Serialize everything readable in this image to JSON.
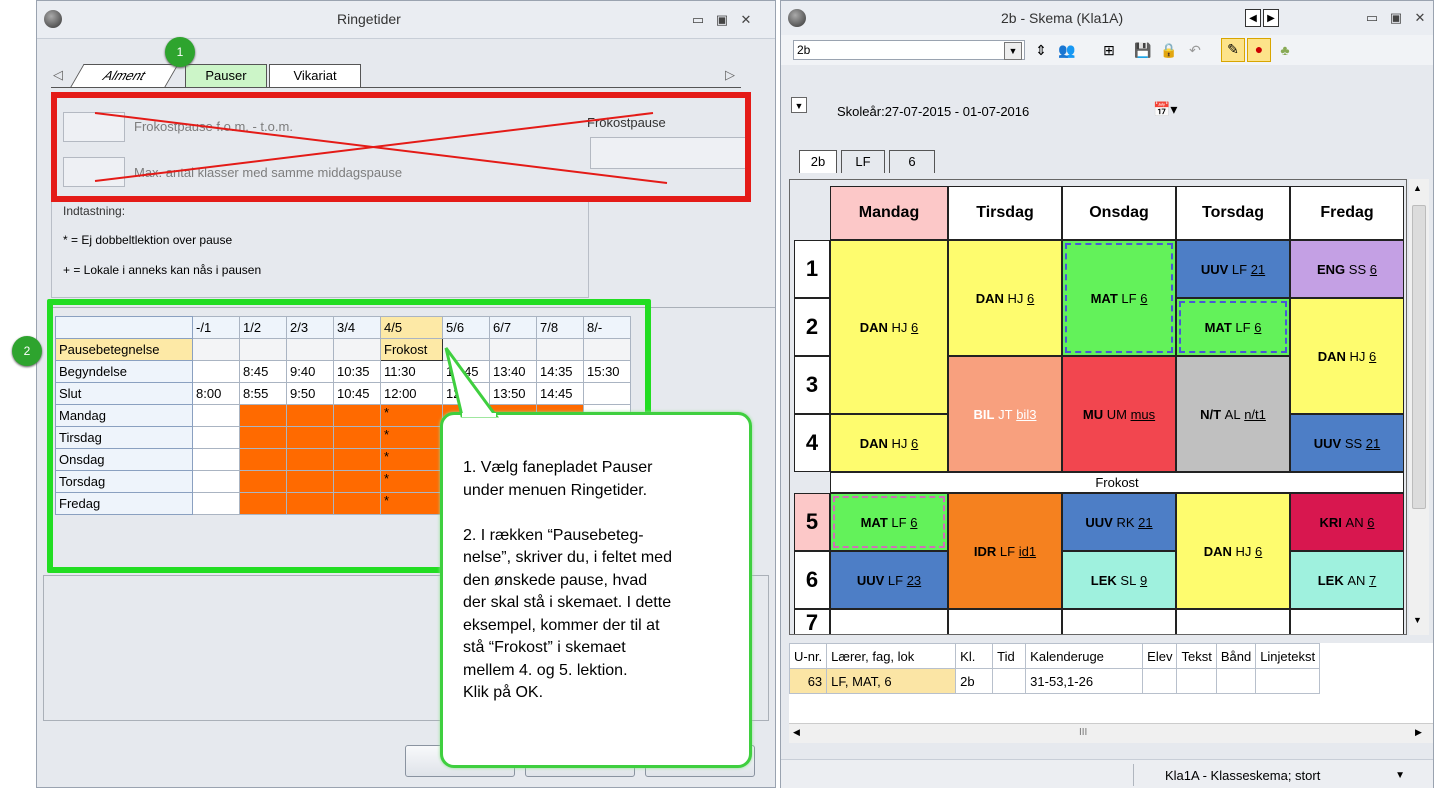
{
  "left_window": {
    "title": "Ringetider",
    "tabs": [
      "Alment",
      "Pauser",
      "Vikariat"
    ],
    "frokost_label": "Frokostpause f.o.m. - t.o.m.",
    "max_label": "Max. antal klasser med samme middagspause",
    "frokostpause_label": "Frokostpause",
    "indtastning_title": "Indtastning:",
    "legend_1": "* = Ej dobbeltlektion over pause",
    "legend_2": "+ = Lokale i anneks kan nås i pausen",
    "columns": [
      "-/1",
      "1/2",
      "2/3",
      "3/4",
      "4/5",
      "5/6",
      "6/7",
      "7/8",
      "8/-"
    ],
    "rows": {
      "pausebetegnelse": "Pausebetegnelse",
      "begyndelse": "Begyndelse",
      "slut": "Slut",
      "days": [
        "Mandag",
        "Tirsdag",
        "Onsdag",
        "Torsdag",
        "Fredag"
      ]
    },
    "frokost_value": "Frokost",
    "begyndelse_values": [
      "",
      "8:45",
      "9:40",
      "10:35",
      "11:30",
      "12:45",
      "13:40",
      "14:35",
      "15:30"
    ],
    "slut_values": [
      "8:00",
      "8:55",
      "9:50",
      "10:45",
      "12:00",
      "12:55",
      "13:50",
      "14:45",
      ""
    ],
    "star": "*",
    "badge_1": "1",
    "badge_2": "2"
  },
  "callout": {
    "text": "1. Vælg fanepladet Pauser\nunder menuen Ringetider.\n\n2. I rækken “Pausebeteg-\nnelse”, skriver du, i feltet med\nden ønskede pause, hvad\nder skal stå i skemaet. I dette\neksempel, kommer der til at\nstå “Frokost” i skemaet\nmellem 4. og 5. lektion.\nKlik på OK."
  },
  "right_window": {
    "title": "2b -  Skema (Kla1A)",
    "selector_value": "2b",
    "skoleaar": "Skoleår:27-07-2015 - 01-07-2016",
    "subtabs": [
      "2b",
      "LF",
      "6"
    ],
    "days": [
      "Mandag",
      "Tirsdag",
      "Onsdag",
      "Torsdag",
      "Fredag"
    ],
    "rows": [
      "1",
      "2",
      "3",
      "4",
      "5",
      "6",
      "7"
    ],
    "frokost": "Frokost",
    "cells": {
      "man_12": {
        "subject": "DAN",
        "teacher": "HJ",
        "room": "6"
      },
      "man_4": {
        "subject": "DAN",
        "teacher": "HJ",
        "room": "6"
      },
      "man_5": {
        "subject": "MAT",
        "teacher": "LF",
        "room": "6"
      },
      "man_6": {
        "subject": "UUV",
        "teacher": "LF",
        "room": "23"
      },
      "tir_12": {
        "subject": "DAN",
        "teacher": "HJ",
        "room": "6"
      },
      "tir_34": {
        "subject": "BIL",
        "teacher": "JT",
        "room": "bil3"
      },
      "tir_56": {
        "subject": "IDR",
        "teacher": "LF",
        "room": "id1"
      },
      "ons_12": {
        "subject": "MAT",
        "teacher": "LF",
        "room": "6"
      },
      "ons_34": {
        "subject": "MU",
        "teacher": "UM",
        "room": "mus"
      },
      "ons_5": {
        "subject": "UUV",
        "teacher": "RK",
        "room": "21"
      },
      "ons_6": {
        "subject": "LEK",
        "teacher": "SL",
        "room": "9"
      },
      "tor_1": {
        "subject": "UUV",
        "teacher": "LF",
        "room": "21"
      },
      "tor_2": {
        "subject": "MAT",
        "teacher": "LF",
        "room": "6"
      },
      "tor_34": {
        "subject": "N/T",
        "teacher": "AL",
        "room": "n/t1"
      },
      "tor_56": {
        "subject": "DAN",
        "teacher": "HJ",
        "room": "6"
      },
      "fre_1": {
        "subject": "ENG",
        "teacher": "SS",
        "room": "6"
      },
      "fre_23": {
        "subject": "DAN",
        "teacher": "HJ",
        "room": "6"
      },
      "fre_4": {
        "subject": "UUV",
        "teacher": "SS",
        "room": "21"
      },
      "fre_5": {
        "subject": "KRI",
        "teacher": "AN",
        "room": "6"
      },
      "fre_6": {
        "subject": "LEK",
        "teacher": "AN",
        "room": "7"
      }
    },
    "lesson_table": {
      "headers": [
        "U-nr.",
        "Lærer, fag, lok",
        "Kl.",
        "Tid",
        "Kalenderuge",
        "Elev",
        "Tekst",
        "Bånd",
        "Linjetekst"
      ],
      "row": [
        "63",
        "LF, MAT, 6",
        "2b",
        "",
        "31-53,1-26",
        "",
        "",
        "",
        ""
      ]
    },
    "scroll_mark": "III",
    "status_select": "Kla1A - Klasseskema; stort"
  }
}
